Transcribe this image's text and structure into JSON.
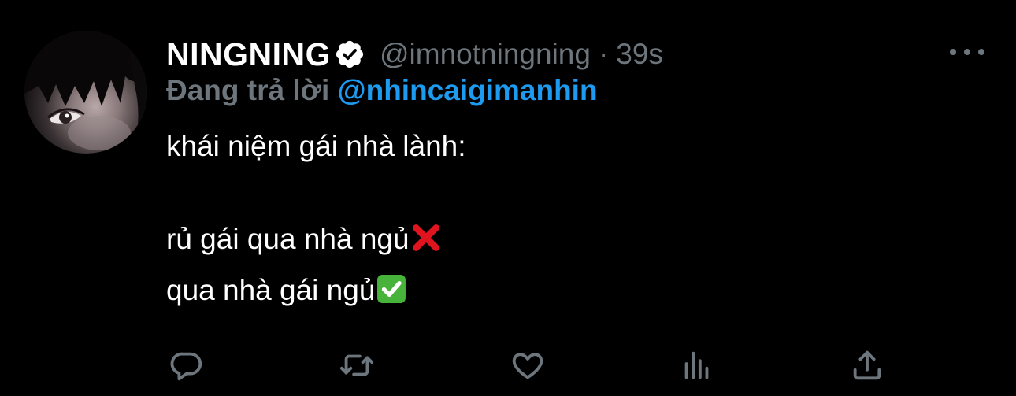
{
  "tweet": {
    "display_name": "NINGNING",
    "handle": "@imnotningning",
    "separator": "·",
    "time": "39s",
    "reply_prefix": "Đang trả lời",
    "reply_target": "@nhincaigimanhin",
    "lines": [
      "khái niệm gái nhà lành:",
      "rủ gái qua nhà ngủ",
      "qua nhà gái ngủ"
    ]
  },
  "icons": {
    "verified": "verified-badge-icon",
    "line2_emoji": "cross-mark-emoji",
    "line3_emoji": "check-mark-emoji",
    "actions": [
      "reply-icon",
      "retweet-icon",
      "like-icon",
      "analytics-icon",
      "share-icon"
    ],
    "more": "more-options-icon"
  },
  "colors": {
    "background": "#000000",
    "text": "#ffffff",
    "muted": "#6e767d",
    "link": "#1d9bf0",
    "cross": "#e0141e",
    "check": "#47b33a"
  }
}
